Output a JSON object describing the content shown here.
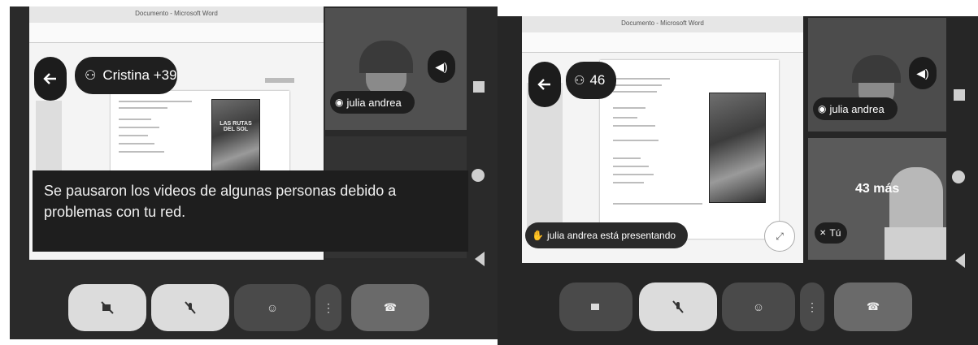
{
  "left_screen": {
    "doc_title": "Documento - Microsoft Word",
    "participants_label": "Cristina +39",
    "speaker_label": "julia andrea",
    "banner_text": "Se pausaron los videos de algunas personas debido a problemas con tu red.",
    "cover_text": "LAS RUTAS DEL SOL"
  },
  "right_screen": {
    "doc_title": "Documento - Microsoft Word",
    "participants_label": "46",
    "speaker_label": "julia andrea",
    "presenting_label": "julia andrea está presentando",
    "more_label": "43 más",
    "self_label": "Tú"
  },
  "icons": {
    "back": "arrow-left-icon",
    "people": "people-icon",
    "volume": "volume-icon",
    "camera_off": "camera-off-icon",
    "mic_off": "mic-off-icon",
    "emoji": "emoji-icon",
    "more": "more-vert-icon",
    "hang_up": "hang-up-icon",
    "nav_square": "recents-icon",
    "nav_circle": "home-icon",
    "nav_triangle": "back-nav-icon"
  }
}
